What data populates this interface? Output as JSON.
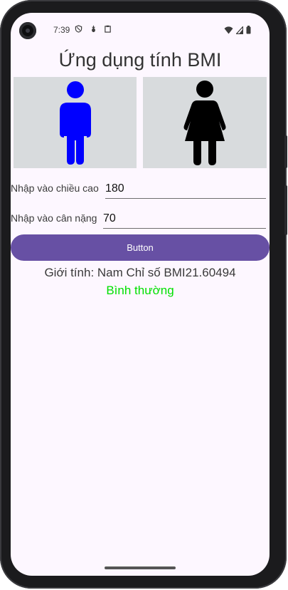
{
  "status_bar": {
    "time": "7:39"
  },
  "app": {
    "title": "Ứng dụng tính BMI"
  },
  "images": {
    "male_color": "#0000ff",
    "female_color": "#000000"
  },
  "height_field": {
    "label": "Nhập vào chiều cao",
    "value": "180"
  },
  "weight_field": {
    "label": "Nhập vào cân nặng",
    "value": "70"
  },
  "button": {
    "label": "Button"
  },
  "result": {
    "text": "Giới tính: Nam Chỉ số BMI21.60494",
    "status": "Bình thường",
    "status_color": "#00e000"
  },
  "colors": {
    "accent": "#6750a4",
    "background": "#fdf7ff",
    "image_bg": "#d8dbdd"
  }
}
